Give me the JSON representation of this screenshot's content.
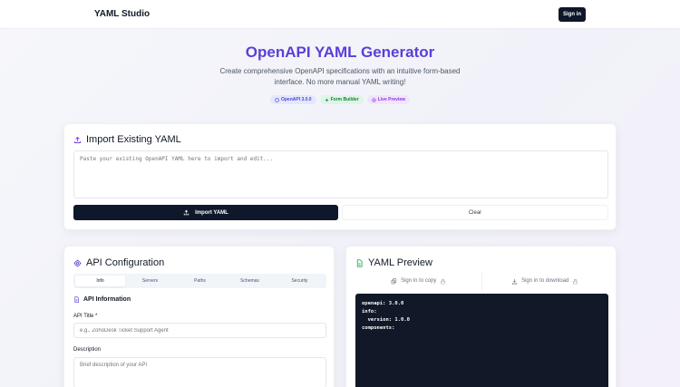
{
  "header": {
    "brand": "YAML Studio",
    "signin_label": "Sign in"
  },
  "hero": {
    "title": "OpenAPI YAML Generator",
    "subtitle": "Create comprehensive OpenAPI specifications with an intuitive form-based interface. No more manual YAML writing!",
    "badges": [
      {
        "label": "OpenAPI 3.0.0",
        "icon": "shield-icon"
      },
      {
        "label": "Form Builder",
        "icon": "plus-icon"
      },
      {
        "label": "Live Preview",
        "icon": "eye-icon"
      }
    ]
  },
  "import": {
    "title": "Import Existing YAML",
    "placeholder": "Paste your existing OpenAPI YAML here to import and edit...",
    "import_label": "Import YAML",
    "clear_label": "Clear"
  },
  "config": {
    "title": "API Configuration",
    "tabs": [
      "Info",
      "Servers",
      "Paths",
      "Schemas",
      "Security"
    ],
    "active_tab": "Info",
    "section_title": "API Information",
    "api_title_label": "API Title *",
    "api_title_placeholder": "e.g., ZohoDesk Ticket Support Agent",
    "description_label": "Description",
    "description_placeholder": "Brief description of your API"
  },
  "preview": {
    "title": "YAML Preview",
    "copy_label": "Sign in to copy",
    "download_label": "Sign in to download",
    "code": "openapi: 3.0.0\ninfo:\n  version: 1.0.0\ncomponents:"
  },
  "colors": {
    "accent": "#5b3fd6",
    "dark_button": "#0f172a",
    "code_bg": "#111827"
  }
}
